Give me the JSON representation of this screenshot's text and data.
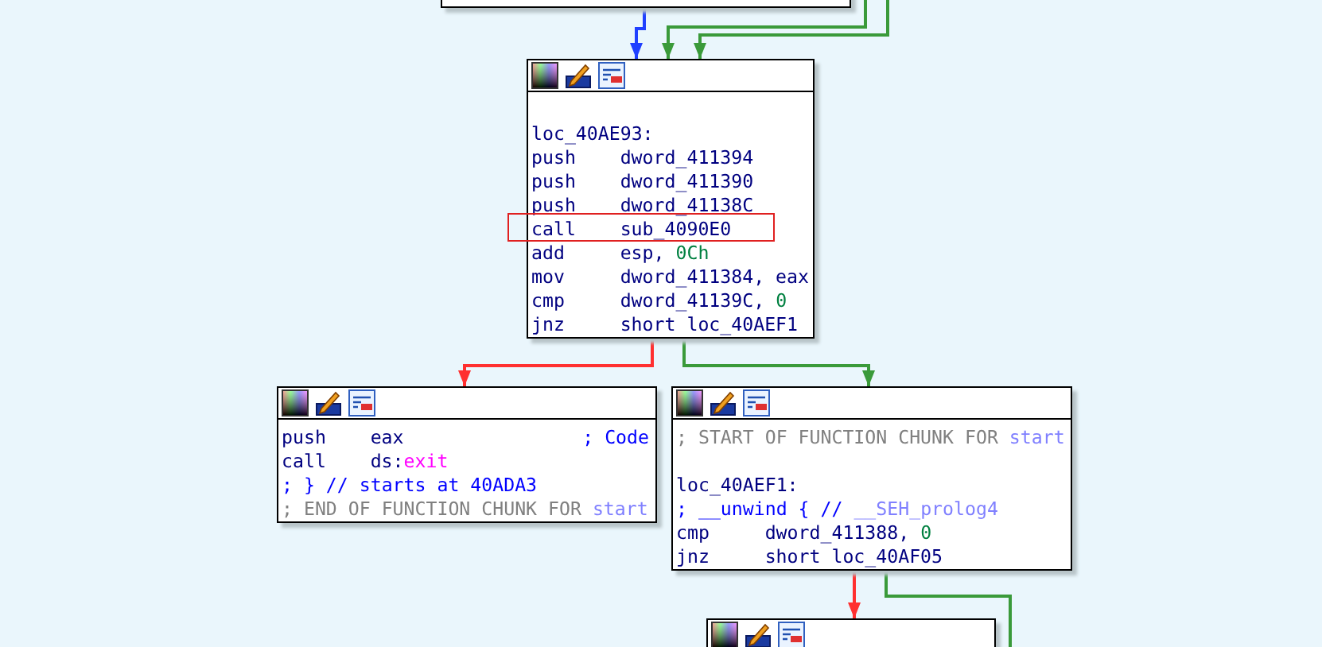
{
  "nodes": [
    {
      "header": true,
      "lines": [
        {
          "kind": "blank"
        },
        {
          "kind": "text",
          "tokens": [
            {
              "text": "loc_40AE93:",
              "kind": "code"
            }
          ]
        },
        {
          "kind": "instr",
          "mnemonic": "push",
          "operands": [
            {
              "text": "dword_411394",
              "kind": "code"
            }
          ]
        },
        {
          "kind": "instr",
          "mnemonic": "push",
          "operands": [
            {
              "text": "dword_411390",
              "kind": "code"
            }
          ]
        },
        {
          "kind": "instr",
          "mnemonic": "push",
          "operands": [
            {
              "text": "dword_41138C",
              "kind": "code"
            }
          ]
        },
        {
          "kind": "instr",
          "mnemonic": "call",
          "operands": [
            {
              "text": "sub_4090E0",
              "kind": "code"
            }
          ],
          "highlighted": true
        },
        {
          "kind": "instr",
          "mnemonic": "add",
          "operands": [
            {
              "text": "esp, ",
              "kind": "code"
            },
            {
              "text": "0Ch",
              "kind": "num"
            }
          ]
        },
        {
          "kind": "instr",
          "mnemonic": "mov",
          "operands": [
            {
              "text": "dword_411384, eax",
              "kind": "code"
            }
          ]
        },
        {
          "kind": "instr",
          "mnemonic": "cmp",
          "operands": [
            {
              "text": "dword_41139C, ",
              "kind": "code"
            },
            {
              "text": "0",
              "kind": "num"
            }
          ]
        },
        {
          "kind": "instr",
          "mnemonic": "jnz",
          "operands": [
            {
              "text": "short loc_40AEF1",
              "kind": "code"
            }
          ]
        }
      ]
    },
    {
      "header": true,
      "lines": [
        {
          "kind": "instr",
          "mnemonic": "push",
          "operands": [
            {
              "text": "eax",
              "kind": "code"
            }
          ],
          "comment": "; Code"
        },
        {
          "kind": "instr",
          "mnemonic": "call",
          "operands": [
            {
              "text": "ds:",
              "kind": "code"
            },
            {
              "text": "exit",
              "kind": "import"
            }
          ]
        },
        {
          "kind": "text",
          "tokens": [
            {
              "text": "; } // starts at 40ADA3",
              "kind": "comment"
            }
          ]
        },
        {
          "kind": "text",
          "tokens": [
            {
              "text": "; END OF FUNCTION CHUNK FOR ",
              "kind": "chunk"
            },
            {
              "text": "start",
              "kind": "ref"
            }
          ]
        }
      ]
    },
    {
      "header": true,
      "lines": [
        {
          "kind": "text",
          "tokens": [
            {
              "text": "; START OF FUNCTION CHUNK FOR ",
              "kind": "chunk"
            },
            {
              "text": "start",
              "kind": "ref"
            }
          ]
        },
        {
          "kind": "blank"
        },
        {
          "kind": "text",
          "tokens": [
            {
              "text": "loc_40AEF1:",
              "kind": "code"
            }
          ]
        },
        {
          "kind": "text",
          "tokens": [
            {
              "text": "; __unwind { // ",
              "kind": "comment"
            },
            {
              "text": "__SEH_prolog4",
              "kind": "ref"
            }
          ]
        },
        {
          "kind": "instr",
          "mnemonic": "cmp",
          "operands": [
            {
              "text": "dword_411388, ",
              "kind": "code"
            },
            {
              "text": "0",
              "kind": "num"
            }
          ]
        },
        {
          "kind": "instr",
          "mnemonic": "jnz",
          "operands": [
            {
              "text": "short loc_40AF05",
              "kind": "code"
            }
          ]
        }
      ]
    },
    {
      "header": true
    }
  ],
  "edges": [
    {
      "kind": "unconditional"
    },
    {
      "kind": "taken"
    },
    {
      "kind": "taken"
    },
    {
      "kind": "not_taken"
    },
    {
      "kind": "taken"
    },
    {
      "kind": "not_taken"
    },
    {
      "kind": "taken"
    }
  ]
}
